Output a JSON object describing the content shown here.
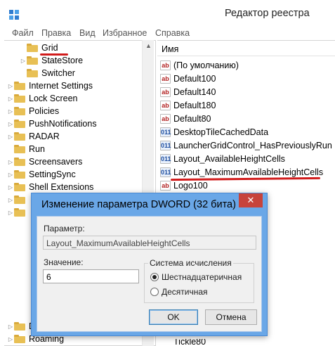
{
  "window": {
    "title": "Редактор реестра",
    "icon": "regedit-icon"
  },
  "menu": [
    "Файл",
    "Правка",
    "Вид",
    "Избранное",
    "Справка"
  ],
  "tree": {
    "items": [
      {
        "label": "Grid",
        "expander": "",
        "selected": true
      },
      {
        "label": "StateStore",
        "expander": "▷"
      },
      {
        "label": "Switcher",
        "expander": ""
      },
      {
        "label": "Internet Settings",
        "expander": "▷"
      },
      {
        "label": "Lock Screen",
        "expander": "▷"
      },
      {
        "label": "Policies",
        "expander": "▷"
      },
      {
        "label": "PushNotifications",
        "expander": "▷"
      },
      {
        "label": "RADAR",
        "expander": "▷"
      },
      {
        "label": "Run",
        "expander": ""
      },
      {
        "label": "Screensavers",
        "expander": "▷"
      },
      {
        "label": "SettingSync",
        "expander": "▷"
      },
      {
        "label": "Shell Extensions",
        "expander": "▷"
      },
      {
        "label": "DW",
        "expander": "▷"
      },
      {
        "label": "Roaming",
        "expander": "▷"
      }
    ]
  },
  "values": {
    "column": "Имя",
    "items": [
      {
        "type": "ab",
        "name": "(По умолчанию)"
      },
      {
        "type": "ab",
        "name": "Default100"
      },
      {
        "type": "ab",
        "name": "Default140"
      },
      {
        "type": "ab",
        "name": "Default180"
      },
      {
        "type": "ab",
        "name": "Default80"
      },
      {
        "type": "dword",
        "name": "DesktopTileCachedData"
      },
      {
        "type": "dword",
        "name": "LauncherGridControl_HasPreviouslyRun"
      },
      {
        "type": "dword",
        "name": "Layout_AvailableHeightCells"
      },
      {
        "type": "dword",
        "name": "Layout_MaximumAvailableHeightCells",
        "selected": true
      },
      {
        "type": "ab",
        "name": "Logo100"
      },
      {
        "type": "ab",
        "name": "Tickle80"
      }
    ],
    "icon_labels": {
      "ab": "ab",
      "dword": "011"
    }
  },
  "dialog": {
    "title": "Изменение параметра DWORD (32 бита)",
    "close_glyph": "✕",
    "param_label": "Параметр:",
    "param_value": "Layout_MaximumAvailableHeightCells",
    "value_label": "Значение:",
    "value": "6",
    "base_group": "Система исчисления",
    "radio_hex": "Шестнадцатеричная",
    "radio_dec": "Десятичная",
    "ok": "OK",
    "cancel": "Отмена"
  },
  "colors": {
    "annotation": "#d11b1b",
    "dialog_frame": "#6aa7e7",
    "close": "#c7433b"
  }
}
